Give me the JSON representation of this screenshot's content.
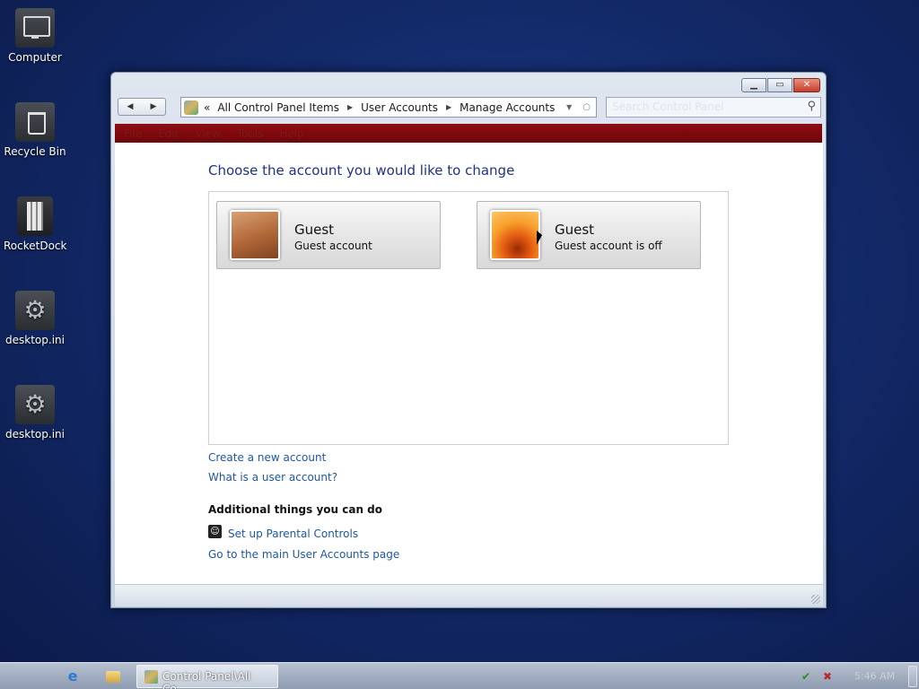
{
  "desktop": {
    "icons": [
      {
        "label": "Computer"
      },
      {
        "label": "Recycle Bin"
      },
      {
        "label": "RocketDock"
      },
      {
        "label": "desktop.ini"
      },
      {
        "label": "desktop.ini"
      }
    ]
  },
  "window": {
    "address": {
      "prefix": "«",
      "crumbs": [
        "All Control Panel Items",
        "User Accounts",
        "Manage Accounts"
      ]
    },
    "search_placeholder": "Search Control Panel",
    "menu": [
      "File",
      "Edit",
      "View",
      "Tools",
      "Help"
    ],
    "heading": "Choose the account you would like to change",
    "accounts": [
      {
        "name": "Guest",
        "description": "Guest account"
      },
      {
        "name": "Guest",
        "description": "Guest account is off"
      }
    ],
    "links": {
      "create": "Create a new account",
      "what_is": "What is a user account?",
      "additional_heading": "Additional things you can do",
      "parental": "Set up Parental Controls",
      "main_page": "Go to the main User Accounts page"
    }
  },
  "taskbar": {
    "task_label": "Control Panel\\All Co...",
    "clock": "5:46 AM"
  }
}
